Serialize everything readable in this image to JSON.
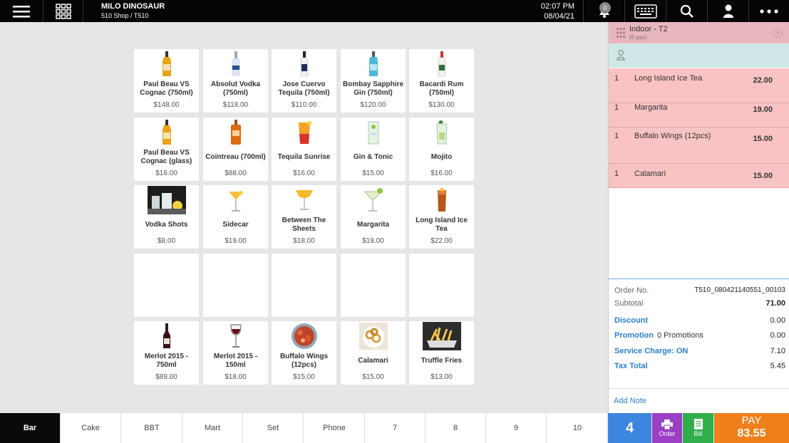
{
  "header": {
    "title": "MILO DINOSAUR",
    "subtitle": "510 Shop / T510",
    "time": "02:07 PM",
    "date": "08/04/21",
    "notification_count": "0",
    "icons": [
      "menu-icon",
      "apps-grid-icon",
      "bell-icon",
      "keyboard-icon",
      "search-icon",
      "user-icon",
      "more-icon"
    ]
  },
  "products": [
    {
      "name": "Paul Beau VS Cognac (750ml)",
      "price": "$148.00",
      "icon": "bottle-cognac"
    },
    {
      "name": "Absolut Vodka (750ml)",
      "price": "$118.00",
      "icon": "bottle-vodka"
    },
    {
      "name": "Jose Cuervo Tequila (750ml)",
      "price": "$110.00",
      "icon": "bottle-tequila"
    },
    {
      "name": "Bombay Sapphire Gin (750ml)",
      "price": "$120.00",
      "icon": "bottle-gin"
    },
    {
      "name": "Bacardi Rum (750ml)",
      "price": "$130.00",
      "icon": "bottle-rum"
    },
    {
      "name": "Paul Beau VS Cognac (glass)",
      "price": "$16.00",
      "icon": "bottle-cognac"
    },
    {
      "name": "Cointreau (700ml)",
      "price": "$88.00",
      "icon": "bottle-cointreau"
    },
    {
      "name": "Tequila Sunrise",
      "price": "$16.00",
      "icon": "glass-sunrise"
    },
    {
      "name": "Gin & Tonic",
      "price": "$15.00",
      "icon": "glass-tonic"
    },
    {
      "name": "Mojito",
      "price": "$16.00",
      "icon": "glass-mojito"
    },
    {
      "name": "Vodka Shots",
      "price": "$8.00",
      "icon": "photo-shots"
    },
    {
      "name": "Sidecar",
      "price": "$19.00",
      "icon": "glass-sidecar"
    },
    {
      "name": "Between The Sheets",
      "price": "$18.00",
      "icon": "glass-sheets"
    },
    {
      "name": "Margarita",
      "price": "$19.00",
      "icon": "glass-margarita"
    },
    {
      "name": "Long Island Ice Tea",
      "price": "$22.00",
      "icon": "glass-icetea"
    },
    {
      "name": "",
      "price": "",
      "icon": ""
    },
    {
      "name": "",
      "price": "",
      "icon": ""
    },
    {
      "name": "",
      "price": "",
      "icon": ""
    },
    {
      "name": "",
      "price": "",
      "icon": ""
    },
    {
      "name": "",
      "price": "",
      "icon": ""
    },
    {
      "name": "Merlot 2015 - 750ml",
      "price": "$89.00",
      "icon": "bottle-wine"
    },
    {
      "name": "Merlot 2015 - 150ml",
      "price": "$18.00",
      "icon": "glass-wine"
    },
    {
      "name": "Buffalo Wings (12pcs)",
      "price": "$15.00",
      "icon": "photo-wings"
    },
    {
      "name": "Calamari",
      "price": "$15.00",
      "icon": "photo-calamari"
    },
    {
      "name": "Truffle Fries",
      "price": "$13.00",
      "icon": "photo-fries"
    }
  ],
  "order": {
    "table": "Indoor - T2",
    "pax": "(6 pax)",
    "lines": [
      {
        "qty": "1",
        "name": "Long Island Ice Tea",
        "amount": "22.00"
      },
      {
        "qty": "1",
        "name": "Margarita",
        "amount": "19.00"
      },
      {
        "qty": "1",
        "name": "Buffalo Wings (12pcs)",
        "amount": "15.00"
      },
      {
        "qty": "1",
        "name": "Calamari",
        "amount": "15.00"
      }
    ],
    "order_no_label": "Order No.",
    "order_no": "T510_080421140551_00103",
    "subtotal_label": "Subtotal",
    "subtotal": "71.00",
    "discount_label": "Discount",
    "discount": "0.00",
    "promotion_label": "Promotion",
    "promotion_text": "0 Promotions",
    "promotion": "0.00",
    "service_label": "Service Charge: ON",
    "service": "7.10",
    "tax_label": "Tax Total",
    "tax": "5.45",
    "add_note": "Add Note"
  },
  "categories": [
    "Bar",
    "Cake",
    "BBT",
    "Mart",
    "Set",
    "Phone",
    "7",
    "8",
    "9",
    "10"
  ],
  "actions": {
    "count": "4",
    "order_label": "Order",
    "bill_label": "Bill",
    "pay_label": "PAY",
    "pay_amount": "83.55"
  },
  "colors": {
    "order_line_bg": "#f9c3c3",
    "table_header_bg": "#e8b7bd",
    "customer_bg": "#cfe7e7",
    "count_btn": "#3d86e0",
    "order_btn": "#9b3fc4",
    "bill_btn": "#2fae4b",
    "pay_btn": "#ef7f1a",
    "link_blue": "#2a7fd0"
  }
}
